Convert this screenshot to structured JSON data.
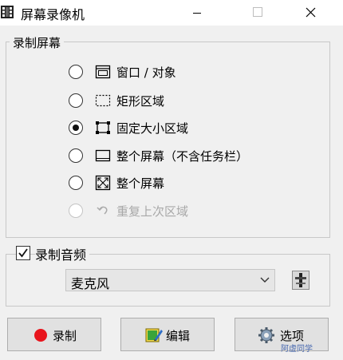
{
  "window": {
    "title": "屏幕录像机",
    "app_icon": "film-strip-icon",
    "minimize_icon": "minimize-icon",
    "maximize_icon": "maximize-icon",
    "close_icon": "close-icon"
  },
  "screen_group": {
    "legend": "录制屏幕",
    "options": [
      {
        "label": "窗口 / 对象",
        "icon": "window-object-icon",
        "selected": false,
        "enabled": true
      },
      {
        "label": "矩形区域",
        "icon": "dashed-rectangle-icon",
        "selected": false,
        "enabled": true
      },
      {
        "label": "固定大小区域",
        "icon": "fixed-region-icon",
        "selected": true,
        "enabled": true
      },
      {
        "label": "整个屏幕（不含任务栏）",
        "icon": "screen-no-taskbar-icon",
        "selected": false,
        "enabled": true
      },
      {
        "label": "整个屏幕",
        "icon": "fullscreen-icon",
        "selected": false,
        "enabled": true
      },
      {
        "label": "重复上次区域",
        "icon": "repeat-arrow-icon",
        "selected": false,
        "enabled": false
      }
    ]
  },
  "audio_group": {
    "checkbox_label": "录制音频",
    "checked": true,
    "device": "麦克风",
    "properties_icon": "audio-properties-icon"
  },
  "buttons": {
    "record": "录制",
    "edit": "编辑",
    "options": "选项"
  },
  "watermark": "阿虚同学",
  "colors": {
    "record_red": "#e8141c",
    "window_bg": "#f0f0f0"
  }
}
